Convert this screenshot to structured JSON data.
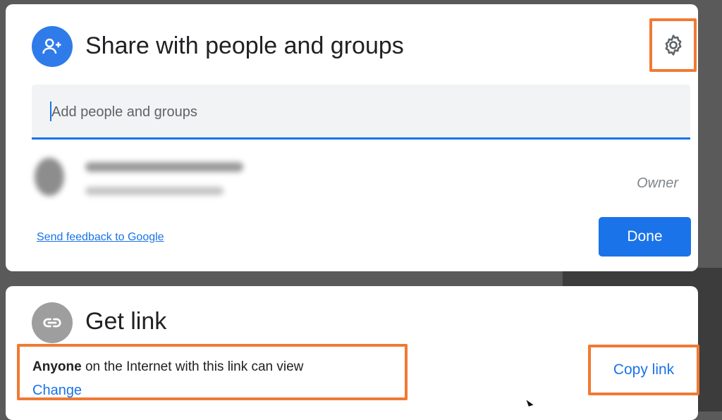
{
  "share_dialog": {
    "title": "Share with people and groups",
    "avatar_icon": "person-add-icon",
    "settings_icon": "gear-icon",
    "add_field_placeholder": "Add people and groups",
    "owner_label": "Owner",
    "feedback_link": "Send feedback to Google",
    "done_button": "Done"
  },
  "link_dialog": {
    "title": "Get link",
    "icon": "link-icon",
    "access_bold": "Anyone",
    "access_rest": " on the Internet with this link can view",
    "change_link": "Change",
    "copy_link": "Copy link"
  },
  "colors": {
    "accent": "#1a73e8",
    "highlight": "#f07a34",
    "share_avatar": "#2f7bea",
    "link_avatar": "#9e9e9e"
  }
}
